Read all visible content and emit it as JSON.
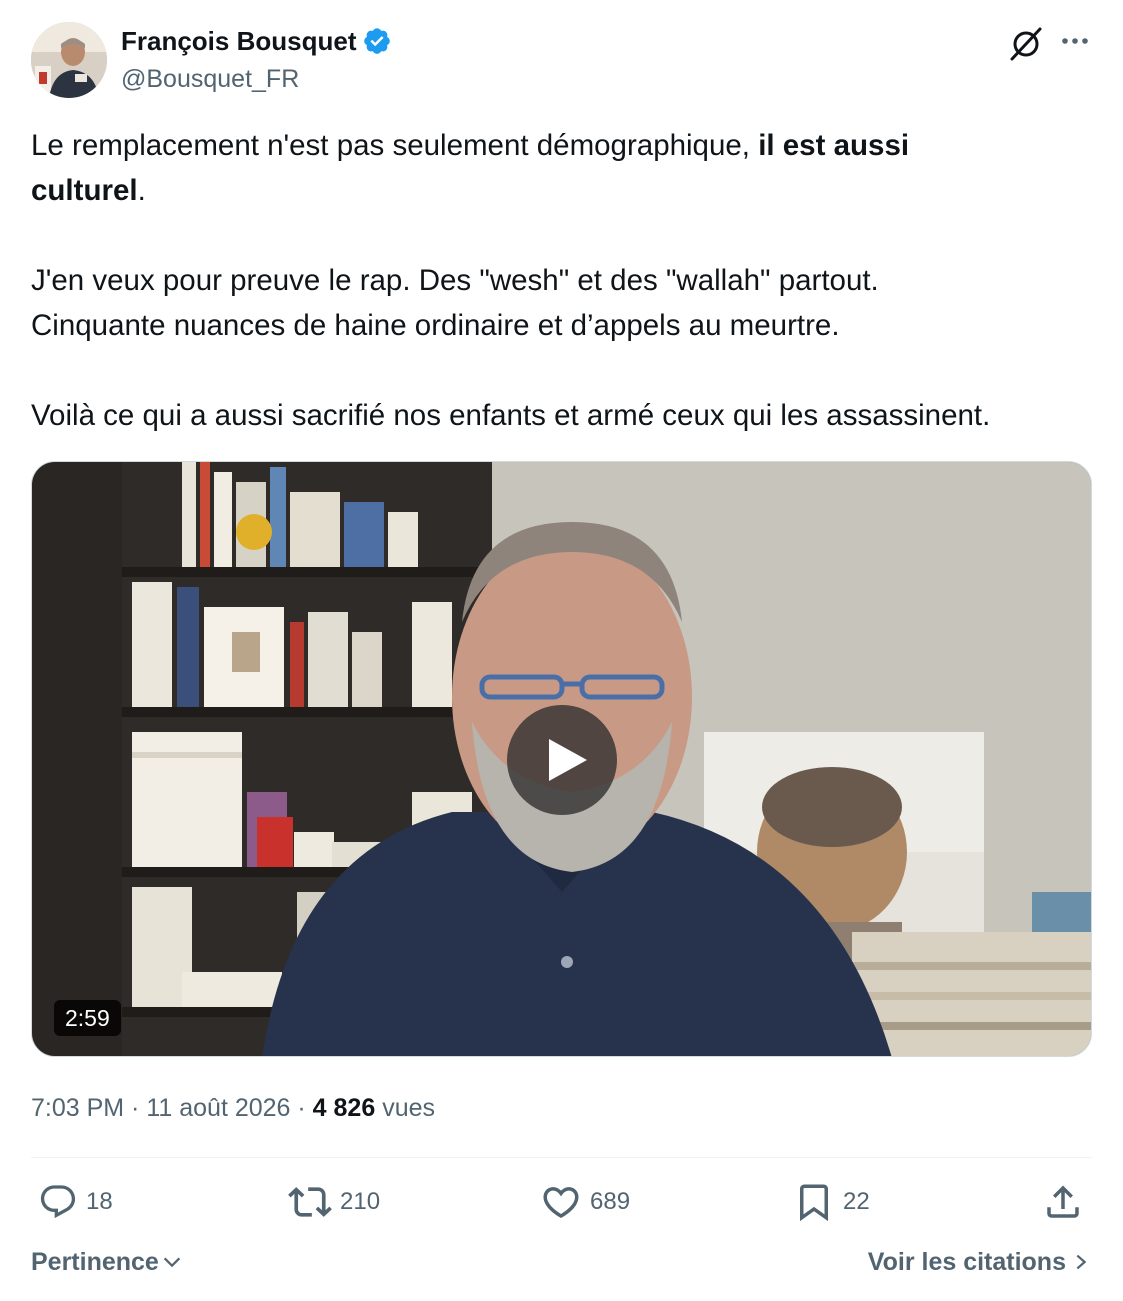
{
  "author": {
    "display_name": "François Bousquet",
    "handle": "@Bousquet_FR",
    "verified": true
  },
  "header_icons": [
    "grok-icon",
    "more-icon"
  ],
  "tweet": {
    "line1_normal": "Le remplacement n'est pas seulement démographique, ",
    "line1_bold": "il est aussi",
    "line2_bold": "culturel",
    "line2_normal": ".",
    "paragraph2_line1": "J'en veux pour preuve le rap. Des \"wesh\" et des \"wallah\" partout.",
    "paragraph2_line2": "Cinquante nuances de haine ordinaire et d’appels au meurtre.",
    "paragraph3": "Voilà ce qui a aussi sacrifié nos enfants et armé ceux qui les assassinent."
  },
  "video": {
    "duration": "2:59"
  },
  "meta": {
    "time": "7:03 PM",
    "separator": " · ",
    "date": "11 août 2026",
    "views_count": "4 826",
    "views_label": "vues"
  },
  "actions": {
    "replies": "18",
    "reposts": "210",
    "likes": "689",
    "bookmarks": "22"
  },
  "footer": {
    "sort_label": "Pertinence",
    "quotes_link": "Voir les citations"
  },
  "colors": {
    "text_primary": "#0f1419",
    "text_secondary": "#536471",
    "verified_blue": "#1d9bf0",
    "divider": "#eff3f4"
  }
}
